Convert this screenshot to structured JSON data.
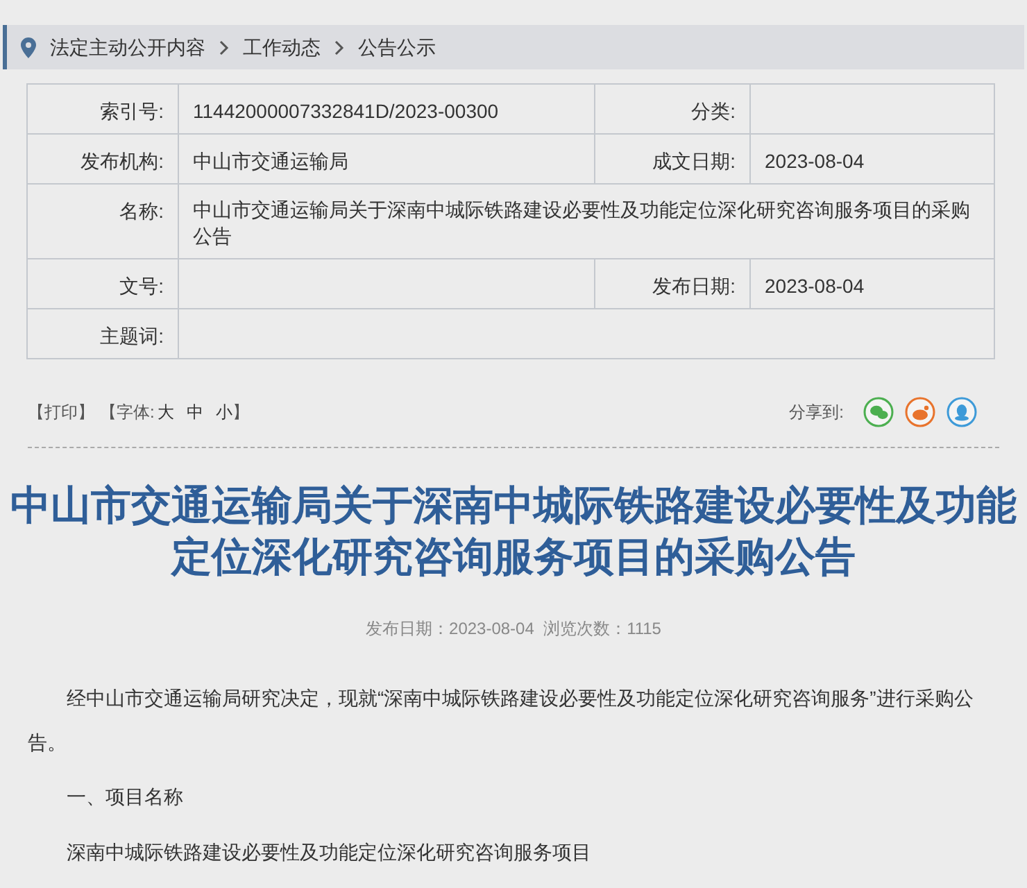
{
  "breadcrumb": [
    "法定主动公开内容",
    "工作动态",
    "公告公示"
  ],
  "meta_table": {
    "rows": [
      {
        "kind": "pair",
        "cells": [
          {
            "label": "索引号:",
            "value": "11442000007332841D/2023-00300"
          },
          {
            "label": "分类:"
          }
        ]
      },
      {
        "kind": "pair",
        "cells": [
          {
            "label": "发布机构:",
            "value": "中山市交通运输局"
          },
          {
            "label": "成文日期:",
            "value": "2023-08-04"
          }
        ]
      },
      {
        "kind": "wide",
        "cells": [
          {
            "label": "名称:",
            "value": "中山市交通运输局关于深南中城际铁路建设必要性及功能定位深化研究咨询服务项目的采购公告"
          }
        ]
      },
      {
        "kind": "pair",
        "cells": [
          {
            "label": "文号:"
          },
          {
            "label": "发布日期:",
            "value": "2023-08-04"
          }
        ]
      },
      {
        "kind": "wide",
        "cells": [
          {
            "label": "主题词:"
          }
        ]
      }
    ]
  },
  "toolbar": {
    "print": "【打印】",
    "font_label": "【字体:",
    "font_sizes": [
      "大",
      "中",
      "小"
    ],
    "font_close": "】",
    "share_label": "分享到:",
    "share": [
      {
        "kind": "wechat",
        "color": "#4caf50"
      },
      {
        "kind": "weibo",
        "color": "#e8732c"
      },
      {
        "kind": "qq",
        "color": "#3d9ad8"
      }
    ]
  },
  "article": {
    "title": "中山市交通运输局关于深南中城际铁路建设必要性及功能定位深化研究咨询服务项目的采购公告",
    "meta": "发布日期：2023-08-04  浏览次数：1115",
    "paragraphs": [
      {
        "kind": "indent",
        "text": "经中山市交通运输局研究决定，现就“深南中城际铁路建设必要性及功能定位深化研究咨询服务”进行采购公告。"
      },
      {
        "kind": "heading",
        "text": "一、项目名称"
      },
      {
        "kind": "heading",
        "text": "深南中城际铁路建设必要性及功能定位深化研究咨询服务项目"
      }
    ]
  }
}
